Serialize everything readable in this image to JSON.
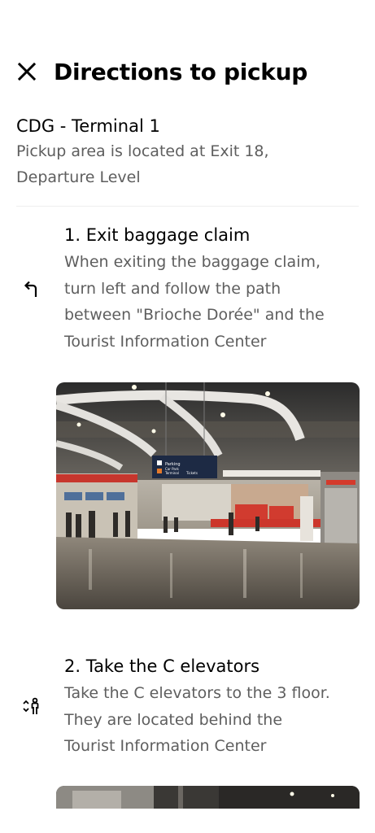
{
  "header": {
    "title": "Directions to pickup",
    "close_icon": "close-icon"
  },
  "location": {
    "name": "CDG - Terminal 1",
    "description_line1": "Pickup area is located at Exit 18,",
    "description_line2": "Departure Level"
  },
  "steps": [
    {
      "icon": "turn-left-icon",
      "title": "1. Exit baggage claim",
      "description_lines": [
        "When exiting the baggage claim,",
        "turn left and follow the path",
        "between \"Brioche Dorée\" and the",
        "Tourist Information Center"
      ],
      "photo": {
        "sign_line1": "Parking",
        "sign_line2": "Car Park",
        "sign_line3": "Terminal",
        "sign_line4": "Tickets"
      }
    },
    {
      "icon": "elevator-icon",
      "title": "2. Take the C elevators",
      "description_lines": [
        "Take the C elevators to the 3 floor.",
        "They are located behind the",
        "Tourist Information Center"
      ]
    }
  ],
  "colors": {
    "text_primary": "#000000",
    "text_secondary": "#5e5e5e",
    "divider": "#eeeeee",
    "background": "#ffffff"
  }
}
